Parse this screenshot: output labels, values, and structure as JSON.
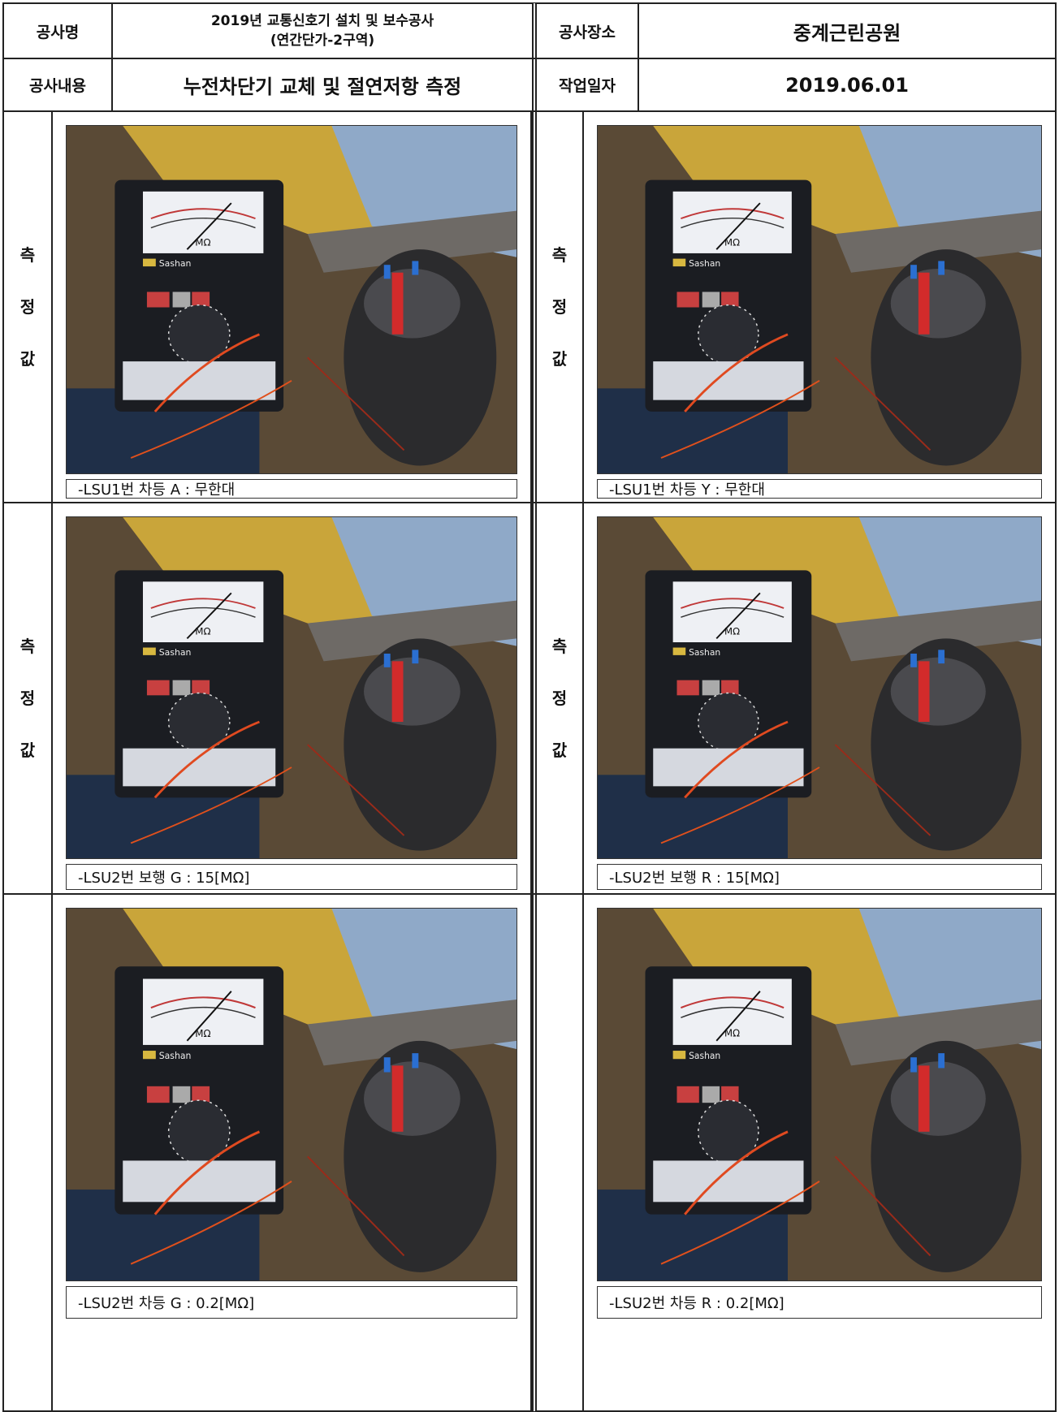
{
  "header": {
    "project_name_label": "공사명",
    "project_name_line1": "2019년 교통신호기 설치 및 보수공사",
    "project_name_line2": "(연간단가-2구역)",
    "site_label": "공사장소",
    "site_value": "중계근린공원",
    "content_label": "공사내용",
    "content_value": "누전차단기 교체 및 절연저항 측정",
    "date_label": "작업일자",
    "date_value": "2019.06.01"
  },
  "side_label_chars": [
    "측",
    "정",
    "값"
  ],
  "photos": [
    {
      "caption": "-LSU1번 차등 A : 무한대",
      "meter_unit": "MΩ",
      "meter_brand": "Sashan"
    },
    {
      "caption": "-LSU1번 차등 Y : 무한대",
      "meter_unit": "MΩ",
      "meter_brand": "Sashan"
    },
    {
      "caption": "-LSU2번 보행 G : 15[MΩ]",
      "meter_unit": "MΩ",
      "meter_brand": "Sashan"
    },
    {
      "caption": "-LSU2번 보행 R : 15[MΩ]",
      "meter_unit": "MΩ",
      "meter_brand": "Sashan"
    },
    {
      "caption": "-LSU2번 차등 G : 0.2[MΩ]",
      "meter_unit": "MΩ",
      "meter_brand": "Sashan"
    },
    {
      "caption": "-LSU2번 차등 R : 0.2[MΩ]",
      "meter_unit": "MΩ",
      "meter_brand": "Sashan"
    }
  ]
}
